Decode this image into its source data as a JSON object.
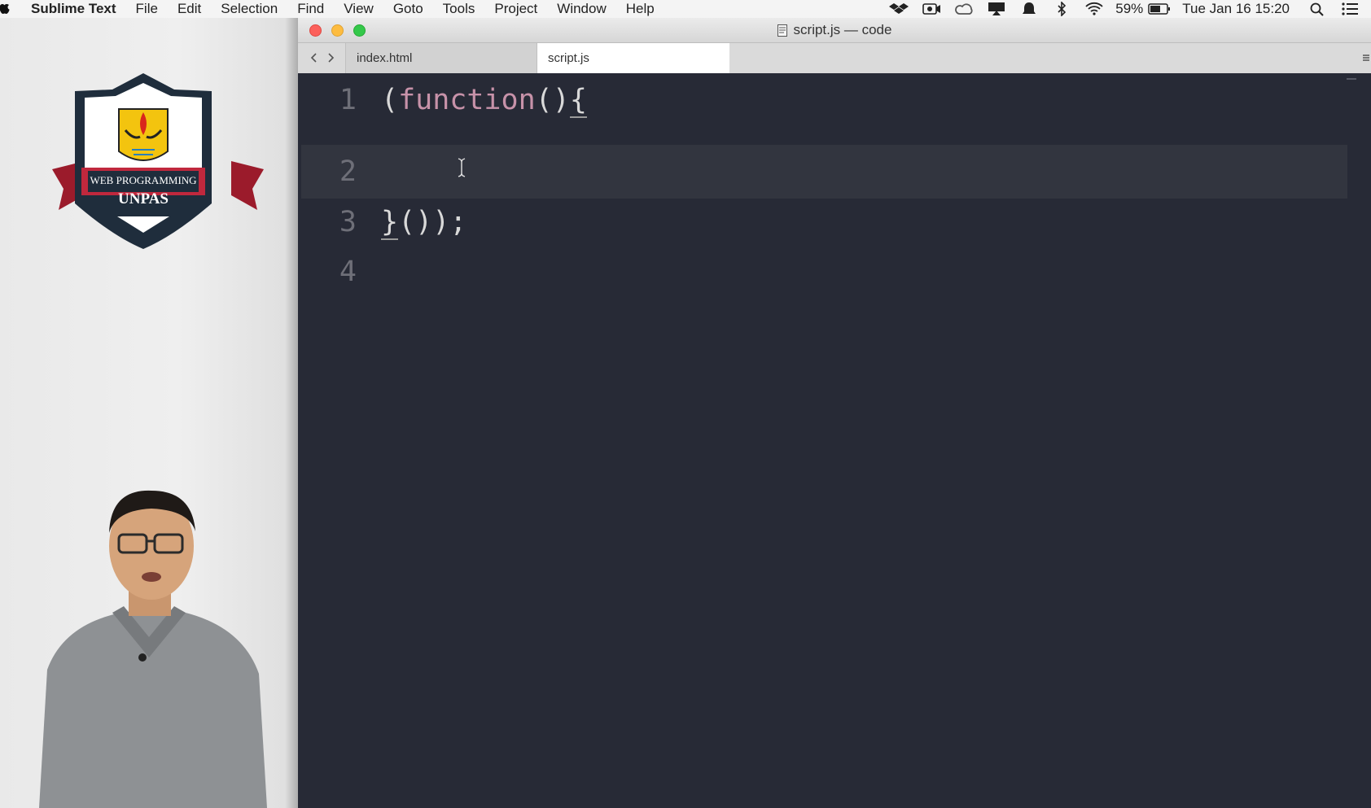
{
  "menubar": {
    "app_name": "Sublime Text",
    "menus": [
      "File",
      "Edit",
      "Selection",
      "Find",
      "View",
      "Goto",
      "Tools",
      "Project",
      "Window",
      "Help"
    ],
    "battery": "59%",
    "datetime": "Tue Jan 16  15:20",
    "status_icons": [
      "dropbox-icon",
      "screen-record-icon",
      "creative-cloud-icon",
      "airplay-icon",
      "notification-bell-icon",
      "bluetooth-icon",
      "wifi-icon",
      "battery-icon",
      "spotlight-search-icon",
      "notification-center-icon"
    ]
  },
  "presenter": {
    "logo_line1": "WEB PROGRAMMING",
    "logo_line2": "UNPAS"
  },
  "window": {
    "title": "script.js — code",
    "tabs": [
      {
        "label": "index.html",
        "active": false
      },
      {
        "label": "script.js",
        "active": true
      }
    ]
  },
  "editor": {
    "lines": [
      {
        "number": "1",
        "text": "(function(){"
      },
      {
        "number": "2",
        "text": ""
      },
      {
        "number": "3",
        "text": "}());"
      },
      {
        "number": "4",
        "text": ""
      }
    ],
    "current_line": "2",
    "colors": {
      "background": "#272a36",
      "keyword": "#c792a9",
      "punctuation": "#d9d9d9",
      "gutter": "#6e6f78"
    }
  }
}
